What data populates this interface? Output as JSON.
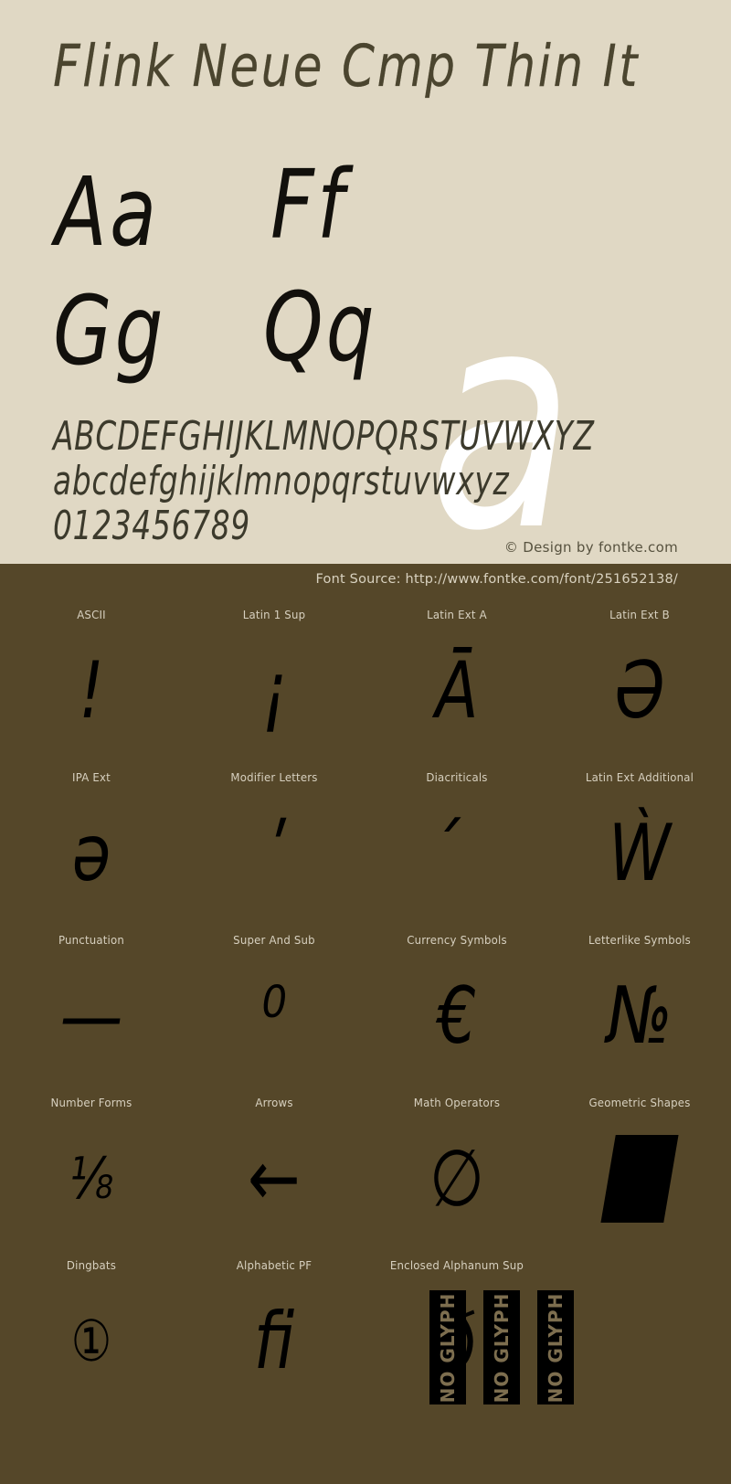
{
  "title": "Flink Neue Cmp Thin It",
  "showcase": {
    "pairs": [
      "Aa",
      "Ff",
      "Gg",
      "Qq"
    ],
    "big_glyph": "a"
  },
  "alphabet": {
    "uppercase": "ABCDEFGHIJKLMNOPQRSTUVWXYZ",
    "lowercase": "abcdefghijklmnopqrstuvwxyz",
    "digits": "0123456789"
  },
  "copyright": "© Design by fontke.com",
  "font_source": "Font Source: http://www.fontke.com/font/251652138/",
  "colors": {
    "top_background": "#e0d8c4",
    "bottom_background": "#554729",
    "glyph_black": "#000000",
    "glyph_white": "#ffffff",
    "label_text": "#d7d0bf"
  },
  "unicode_blocks": [
    {
      "label": "ASCII",
      "sample": "!",
      "size": "normal"
    },
    {
      "label": "Latin 1 Sup",
      "sample": "¡",
      "size": "normal"
    },
    {
      "label": "Latin Ext A",
      "sample": "Ā",
      "size": "normal"
    },
    {
      "label": "Latin Ext B",
      "sample": "Ə",
      "size": "normal"
    },
    {
      "label": "IPA Ext",
      "sample": "ə",
      "size": "normal"
    },
    {
      "label": "Modifier Letters",
      "sample": "ʹ",
      "size": "normal"
    },
    {
      "label": "Diacriticals",
      "sample": "́",
      "size": "normal"
    },
    {
      "label": "Latin Ext Additional",
      "sample": "Ẁ",
      "size": "normal"
    },
    {
      "label": "Punctuation",
      "sample": "—",
      "size": "normal"
    },
    {
      "label": "Super And Sub",
      "sample": "⁰",
      "size": "normal"
    },
    {
      "label": "Currency Symbols",
      "sample": "€",
      "size": "normal"
    },
    {
      "label": "Letterlike Symbols",
      "sample": "№",
      "size": "normal"
    },
    {
      "label": "Number Forms",
      "sample": "⅛",
      "size": "small"
    },
    {
      "label": "Arrows",
      "sample": "←",
      "size": "normal"
    },
    {
      "label": "Math Operators",
      "sample": "∅",
      "size": "normal"
    },
    {
      "label": "Geometric Shapes",
      "sample": "",
      "size": "shape"
    },
    {
      "label": "Dingbats",
      "sample": "①",
      "size": "small"
    },
    {
      "label": "Alphabetic PF",
      "sample": "ﬁ",
      "size": "normal"
    },
    {
      "label": "Enclosed Alphanum Sup",
      "sample": "ð",
      "size": "normal"
    },
    {
      "label": "",
      "sample": "",
      "size": "empty"
    }
  ],
  "no_glyph": {
    "label": "NO GLYPH",
    "count": 3
  }
}
